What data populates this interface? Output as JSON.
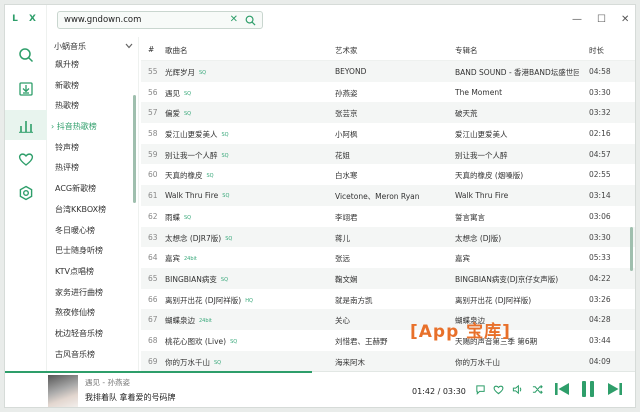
{
  "search": {
    "value": "www.gndown.com"
  },
  "logo": "L X",
  "colors": {
    "accent": "#2e9e6a",
    "watermark": "#e8702a"
  },
  "nav": [
    {
      "icon": "search-icon"
    },
    {
      "icon": "download-icon"
    },
    {
      "icon": "leaderboard-icon"
    },
    {
      "icon": "heart-icon"
    },
    {
      "icon": "settings-icon"
    }
  ],
  "source": "小蜗音乐",
  "categories": [
    "飙升榜",
    "新歌榜",
    "热歌榜",
    "抖音热歌榜",
    "铃声榜",
    "热评榜",
    "ACG新歌榜",
    "台湾KKBOX榜",
    "冬日暖心榜",
    "巴士随身听榜",
    "KTV点唱榜",
    "家务进行曲榜",
    "熬夜修仙榜",
    "枕边轻音乐榜",
    "古风音乐榜"
  ],
  "active_category": "抖音热歌榜",
  "columns": {
    "no": "#",
    "title": "歌曲名",
    "artist": "艺术家",
    "album": "专辑名",
    "time": "时长"
  },
  "songs": [
    {
      "no": "55",
      "title": "光辉岁月",
      "tag": "SQ",
      "artist": "BEYOND",
      "album": "BAND SOUND - 香港BAND坛盛世回...",
      "time": "04:58"
    },
    {
      "no": "56",
      "title": "遇见",
      "tag": "SQ",
      "artist": "孙燕姿",
      "album": "The Moment",
      "time": "03:30"
    },
    {
      "no": "57",
      "title": "偏爱",
      "tag": "SQ",
      "artist": "张芸京",
      "album": "破天荒",
      "time": "03:32"
    },
    {
      "no": "58",
      "title": "爱江山更爱美人",
      "tag": "SQ",
      "artist": "小阿枫",
      "album": "爱江山更爱美人",
      "time": "02:16"
    },
    {
      "no": "59",
      "title": "别让我一个人醉",
      "tag": "SQ",
      "artist": "花姐",
      "album": "别让我一个人醉",
      "time": "04:57"
    },
    {
      "no": "60",
      "title": "天真的橡皮",
      "tag": "SQ",
      "artist": "白水寒",
      "album": "天真的橡皮 (烟嗓版)",
      "time": "02:55"
    },
    {
      "no": "61",
      "title": "Walk Thru Fire",
      "tag": "SQ",
      "artist": "Vicetone、Meron Ryan",
      "album": "Walk Thru Fire",
      "time": "03:14"
    },
    {
      "no": "62",
      "title": "雨蝶",
      "tag": "SQ",
      "artist": "李翊君",
      "album": "誓言寓言",
      "time": "03:06"
    },
    {
      "no": "63",
      "title": "太想念 (DJR7版)",
      "tag": "SQ",
      "artist": "蒋儿",
      "album": "太想念 (DJ版)",
      "time": "03:30"
    },
    {
      "no": "64",
      "title": "嘉宾",
      "tag": "24bit",
      "artist": "张远",
      "album": "嘉宾",
      "time": "05:33"
    },
    {
      "no": "65",
      "title": "BINGBIAN病变",
      "tag": "SQ",
      "artist": "鞠文娴",
      "album": "BINGBIAN病变(DJ京仔女声版)",
      "time": "04:22"
    },
    {
      "no": "66",
      "title": "离别开出花 (DJ阿祥版)",
      "tag": "HQ",
      "artist": "就是南方凯",
      "album": "离别开出花 (DJ阿祥版)",
      "time": "03:26"
    },
    {
      "no": "67",
      "title": "蝴蝶泉边",
      "tag": "24bit",
      "artist": "关心",
      "album": "蝴蝶泉边",
      "time": "04:28"
    },
    {
      "no": "68",
      "title": "桃花心图欢 (Live)",
      "tag": "SQ",
      "artist": "刘惜君、王赫野",
      "album": "天赐的声音第三季 第6期",
      "time": "03:44"
    },
    {
      "no": "69",
      "title": "你的万水千山",
      "tag": "SQ",
      "artist": "海来阿木",
      "album": "你的万水千山",
      "time": "04:09"
    }
  ],
  "watermark": "[App 宝库]",
  "player": {
    "title": "遇见 - 孙燕姿",
    "lyric": "我排着队 拿着爱的号码牌",
    "time": "01:42 / 03:30",
    "progress": 0.486
  }
}
